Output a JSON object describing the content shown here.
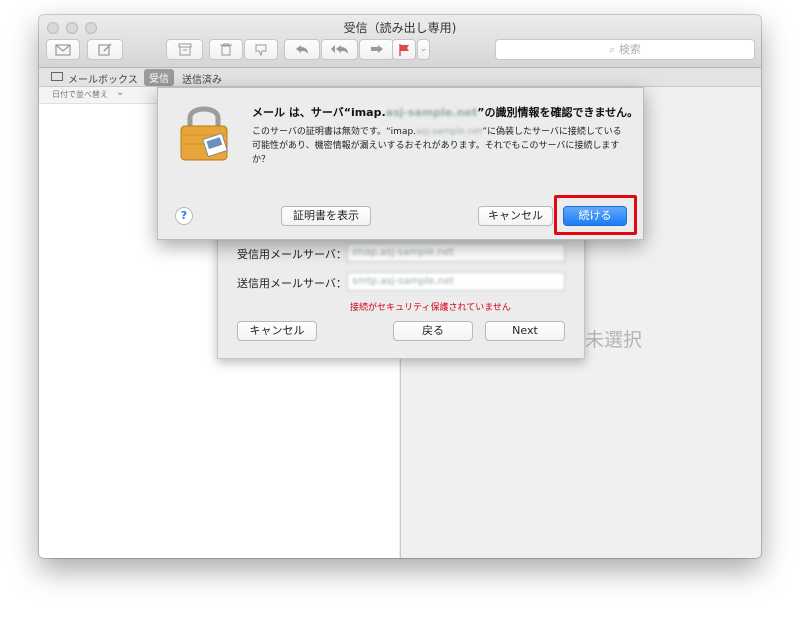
{
  "window": {
    "title": "受信（読み出し専用)"
  },
  "toolbar": {
    "search_placeholder": "検索",
    "icons": [
      "envelope-icon",
      "compose-icon",
      "archive-icon",
      "trash-icon",
      "junk-icon",
      "reply-icon",
      "reply-all-icon",
      "forward-icon",
      "flag-icon",
      "chevron-down-icon",
      "search-icon"
    ]
  },
  "favbar": {
    "mailboxes": "メールボックス",
    "inbox": "受信",
    "sent": "送信済み"
  },
  "list": {
    "sort_label": "日付で並べ替え"
  },
  "viewer": {
    "no_message": "ジ未選択"
  },
  "setup_sheet": {
    "incoming_label": "受信用メールサーバ：",
    "incoming_value": "imap.asj-sample.net",
    "outgoing_label": "送信用メールサーバ：",
    "outgoing_value": "smtp.asj-sample.net",
    "warning": "接続がセキュリティ保護されていません",
    "cancel": "キャンセル",
    "back": "戻る",
    "next": "Next"
  },
  "dialog": {
    "title_pre": "メール は、サーバ“imap.",
    "title_blur": "asj-sample.net",
    "title_post": "”の識別情報を確認できません。",
    "body_pre": "このサーバの証明書は無効です。“imap.",
    "body_blur": "asj-sample.net",
    "body_post": "”に偽装したサーバに接続している可能性があり、機密情報が漏えいするおそれがあります。それでもこのサーバに接続しますか？",
    "help": "?",
    "show_cert": "証明書を表示",
    "cancel": "キャンセル",
    "continue": "続ける"
  },
  "colors": {
    "highlight": "#e30613",
    "primary": "#1a7cf3",
    "warning": "#d0021b"
  }
}
